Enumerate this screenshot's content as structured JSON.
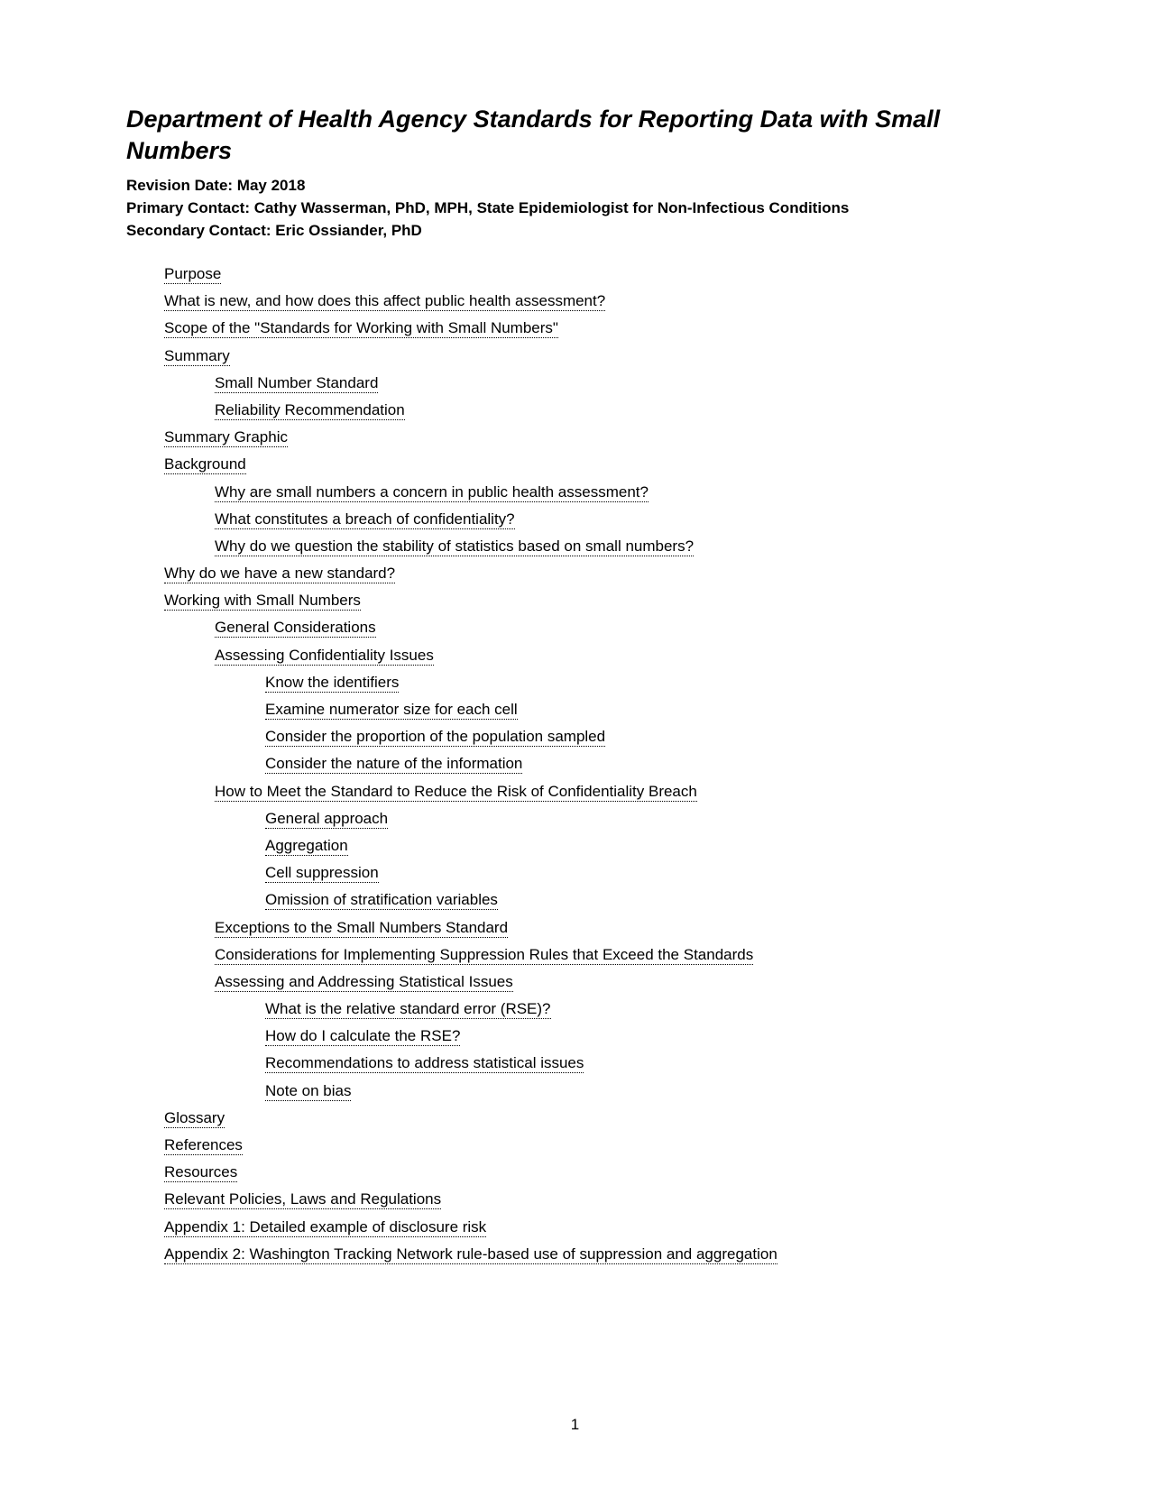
{
  "title": "Department of Health Agency Standards for Reporting Data with Small Numbers",
  "revision": "Revision Date: May 2018",
  "primary_contact": "Primary Contact: Cathy Wasserman, PhD, MPH, State Epidemiologist for Non-Infectious Conditions",
  "secondary_contact": "Secondary Contact: Eric Ossiander, PhD",
  "toc": [
    {
      "label": "Purpose",
      "level": 0
    },
    {
      "label": "What is new, and how does this affect public health assessment?",
      "level": 0
    },
    {
      "label": "Scope of the \"Standards for Working with Small Numbers\"",
      "level": 0
    },
    {
      "label": "Summary",
      "level": 0
    },
    {
      "label": "Small Number Standard",
      "level": 1
    },
    {
      "label": "Reliability Recommendation",
      "level": 1
    },
    {
      "label": "Summary Graphic",
      "level": 0
    },
    {
      "label": "Background",
      "level": 0
    },
    {
      "label": "Why are small numbers a concern in public health assessment?",
      "level": 1
    },
    {
      "label": "What constitutes a breach of confidentiality?",
      "level": 1
    },
    {
      "label": "Why do we question the stability of statistics based on small numbers?",
      "level": 1
    },
    {
      "label": "Why do we have a new standard?",
      "level": 0
    },
    {
      "label": "Working with Small Numbers",
      "level": 0
    },
    {
      "label": "General Considerations",
      "level": 1
    },
    {
      "label": "Assessing Confidentiality Issues",
      "level": 1
    },
    {
      "label": "Know the identifiers",
      "level": 2
    },
    {
      "label": "Examine numerator size for each cell",
      "level": 2
    },
    {
      "label": "Consider the proportion of the population sampled",
      "level": 2
    },
    {
      "label": "Consider the nature of the information",
      "level": 2
    },
    {
      "label": "How to Meet the Standard to Reduce the Risk of Confidentiality Breach",
      "level": 1
    },
    {
      "label": "General approach",
      "level": 2
    },
    {
      "label": "Aggregation",
      "level": 2
    },
    {
      "label": "Cell suppression",
      "level": 2
    },
    {
      "label": "Omission of stratification variables",
      "level": 2
    },
    {
      "label": "Exceptions to the Small Numbers Standard",
      "level": 1
    },
    {
      "label": "Considerations for Implementing Suppression Rules that Exceed the Standards",
      "level": 1
    },
    {
      "label": "Assessing and Addressing Statistical Issues",
      "level": 1
    },
    {
      "label": "What is the relative standard error (RSE)?",
      "level": 2
    },
    {
      "label": "How do I calculate the RSE?",
      "level": 2
    },
    {
      "label": "Recommendations to address statistical issues",
      "level": 2
    },
    {
      "label": "Note on bias",
      "level": 2
    },
    {
      "label": "Glossary",
      "level": 0
    },
    {
      "label": "References",
      "level": 0
    },
    {
      "label": "Resources",
      "level": 0
    },
    {
      "label": "Relevant Policies, Laws and Regulations",
      "level": 0
    },
    {
      "label": "Appendix 1: Detailed example of disclosure risk",
      "level": 0
    },
    {
      "label": "Appendix 2: Washington Tracking Network rule-based use of suppression and aggregation",
      "level": 0
    }
  ],
  "page_number": "1"
}
